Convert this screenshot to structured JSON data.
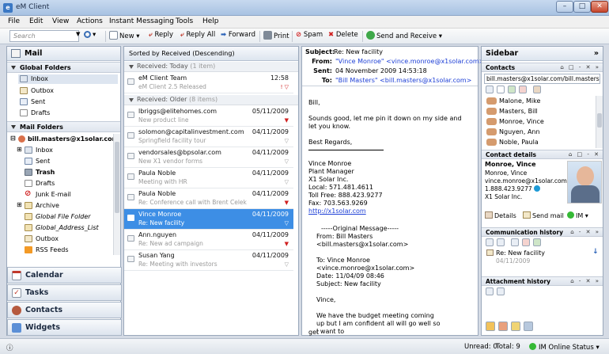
{
  "window": {
    "title": "eM Client"
  },
  "menu": [
    "File",
    "Edit",
    "View",
    "Actions",
    "Instant Messaging",
    "Tools",
    "Help"
  ],
  "toolbar": {
    "search_placeholder": "Search",
    "new": "New",
    "reply": "Reply",
    "reply_all": "Reply All",
    "forward": "Forward",
    "print": "Print",
    "spam": "Spam",
    "delete": "Delete",
    "send_receive": "Send and Receive"
  },
  "left": {
    "header": "Mail",
    "global_folders_header": "Global Folders",
    "global_folders": [
      "Inbox",
      "Outbox",
      "Sent",
      "Drafts"
    ],
    "mail_folders_header": "Mail Folders",
    "account": "bill.masters@x1solar.com",
    "account_folders": [
      "Inbox",
      "Sent",
      "Trash",
      "Drafts",
      "Junk E-mail",
      "Archive",
      "Global File Folder",
      "Global_Address_List",
      "Outbox",
      "RSS Feeds"
    ],
    "nav": [
      "Calendar",
      "Tasks",
      "Contacts",
      "Widgets"
    ]
  },
  "list": {
    "sort_label": "Sorted by Received (Descending)",
    "group_today": "Received: Today",
    "group_today_count": "(1 item)",
    "group_older": "Received: Older",
    "group_older_count": "(8 items)",
    "messages": [
      {
        "from": "eM Client Team",
        "subject": "eM Client 2.5 Released",
        "date": "12:58"
      },
      {
        "from": "lbriggs@elitehomes.com",
        "subject": "New product line",
        "date": "05/11/2009"
      },
      {
        "from": "solomon@capitalinvestment.com",
        "subject": "Springfield facility tour",
        "date": "04/11/2009"
      },
      {
        "from": "vendorsales@bpsolar.com",
        "subject": "New X1 vendor forms",
        "date": "04/11/2009"
      },
      {
        "from": "Paula Noble",
        "subject": "Meeting with HR",
        "date": "04/11/2009"
      },
      {
        "from": "Paula Noble",
        "subject": "Re: Conference call with Brent Celek",
        "date": "04/11/2009"
      },
      {
        "from": "Vince Monroe",
        "subject": "Re: New facility",
        "date": "04/11/2009"
      },
      {
        "from": "Ann.nguyen",
        "subject": "Re: New ad campaign",
        "date": "04/11/2009"
      },
      {
        "from": "Susan Yang",
        "subject": "Re: Meeting with investors",
        "date": "04/11/2009"
      }
    ]
  },
  "reading": {
    "subject_label": "Subject:",
    "subject": "Re: New facility",
    "from_label": "From:",
    "from_name": "\"Vince Monroe\"",
    "from_email": "<vince.monroe@x1solar.com>",
    "sent_label": "Sent:",
    "sent": "04 November 2009 14:53:18",
    "to_label": "To:",
    "to_name": "\"Bill Masters\"",
    "to_email": "<bill.masters@x1solar.com>",
    "greeting": "Bill,",
    "body1": "Sounds good, let me pin it down on my side and let you know.",
    "regards": "Best Regards,",
    "sig": [
      "Vince Monroe",
      "Plant Manager",
      "X1 Solar Inc.",
      "Local: 571.481.4611",
      "Toll Free: 888.423.9277",
      "Fax: 703.563.9269"
    ],
    "sig_link": "http://x1solar.com",
    "orig_header": "-----Original Message-----",
    "orig_from": "From: Bill Masters <bill.masters@x1solar.com>",
    "orig_to": "To: Vince Monroe",
    "orig_to_email": "<vince.monroe@x1solar.com>",
    "orig_date": "Date: 11/04/09 08:46",
    "orig_subject": "Subject: New facility",
    "orig_greeting": "Vince,",
    "orig_body": "We have the budget meeting coming up but I am confident all will go well so I want to",
    "orig_tail": "get"
  },
  "sidebar": {
    "title": "Sidebar",
    "contacts_header": "Contacts",
    "contacts_account": "bill.masters@x1solar.com/bill.masters",
    "contacts": [
      "Malone, Mike",
      "Masters, Bill",
      "Monroe, Vince",
      "Nguyen, Ann",
      "Noble, Paula"
    ],
    "details_header": "Contact details",
    "details_name": "Monroe, Vince",
    "details_lines": [
      "Monroe, Vince",
      "vince.monroe@x1solar.com",
      "1.888.423.9277",
      "X1 Solar Inc."
    ],
    "details_btn": "Details",
    "sendmail_btn": "Send mail",
    "im_btn": "IM",
    "history_header": "Communication history",
    "history_subject": "Re: New facility",
    "history_date": "04/11/2009",
    "attach_header": "Attachment history"
  },
  "status": {
    "unread": "Unread: 0",
    "total": "Total: 9",
    "im": "IM Online Status"
  }
}
